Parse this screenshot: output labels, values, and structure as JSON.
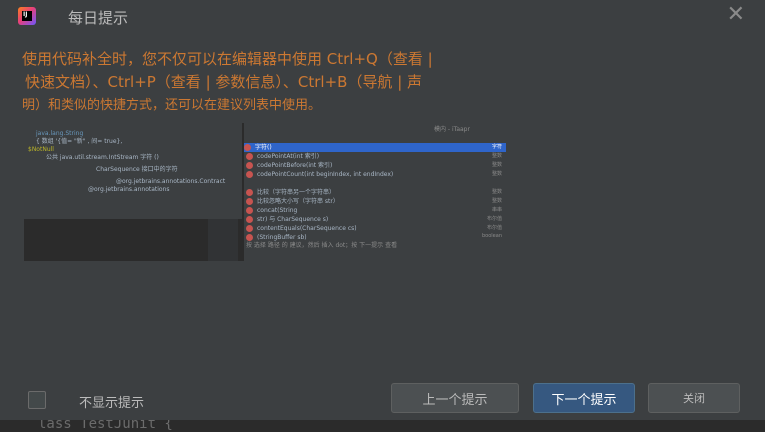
{
  "dialog": {
    "title": "每日提示",
    "tip_lines": [
      "使用代码补全时，您不仅可以在编辑器中使用 Ctrl+Q（查看 |",
      "快速文档）、Ctrl+P（查看 | 参数信息）、Ctrl+B（导航 | 声",
      "明）和类似的快捷方式，还可以在建议列表中使用。"
    ],
    "dont_show_label": "不显示提示",
    "prev_label": "上一个提示",
    "next_label": "下一个提示",
    "close_label": "关闭"
  },
  "screenshot": {
    "left_rows": [
      "java.lang.String",
      "{ 数组 '{值= \"新\" , 间= true},",
      "$NotNull",
      "公共 java.util.stream.IntStream 字符 ()",
      "CharSequence 接口中的字符",
      "@org.jetbrains.annotations.Contract",
      "@org.jetbrains.annotations"
    ],
    "right_header": "模内 - iTaapr",
    "right_items": [
      "字符()",
      "codePointAt(int 索引)",
      "codePointBefore(int 索引)",
      "codePointCount(int beginIndex, int endIndex)",
      "比较（字符串另一个字符串）",
      "比较忽略大小写（字符串 str）",
      "concat(String",
      "str) 与 CharSequence s)",
      "contentEquals(CharSequence cs)",
      "(StringBuffer sb)"
    ],
    "right_tags": [
      "字符",
      "整数",
      "整数",
      "整数",
      "整数",
      "整数",
      "串串",
      "布尔值",
      "布尔值",
      "boolean"
    ],
    "footer_hint": "按 选择 路径 的 建议，然后 插入 dot；按 下一提示 查看"
  },
  "background": {
    "bottom_code": "lass TestJunit {",
    "left_char": "u"
  },
  "colors": {
    "dialog_bg": "#3c3f41",
    "accent_text": "#cc7832",
    "primary_button": "#365880"
  },
  "icons": {
    "app": "intellij-app-icon",
    "close": "close-icon"
  }
}
